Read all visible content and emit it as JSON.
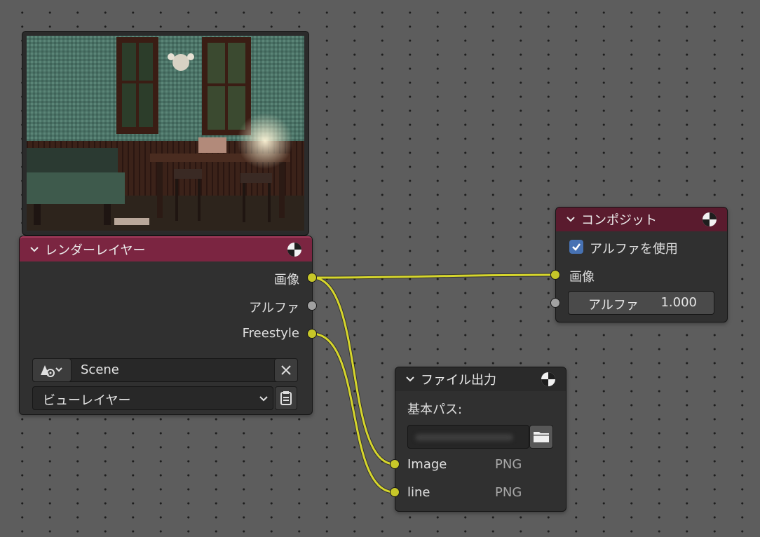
{
  "render_layers_node": {
    "title": "レンダーレイヤー",
    "outputs": [
      "画像",
      "アルファ",
      "Freestyle"
    ],
    "scene_field": "Scene",
    "view_layer_field": "ビューレイヤー",
    "header_color": "#7b2541"
  },
  "composite_node": {
    "title": "コンポジット",
    "use_alpha_label": "アルファを使用",
    "use_alpha_checked": true,
    "image_input_label": "画像",
    "alpha_field_label": "アルファ",
    "alpha_field_value": "1.000",
    "header_color": "#5a1b2e"
  },
  "file_output_node": {
    "title": "ファイル出力",
    "base_path_label": "基本パス:",
    "inputs": [
      {
        "label": "Image",
        "format": "PNG"
      },
      {
        "label": "line",
        "format": "PNG"
      }
    ]
  },
  "colors": {
    "socket_color": "#c7c729",
    "wire_color": "#d6d62c",
    "background": "#5d5d5d"
  }
}
